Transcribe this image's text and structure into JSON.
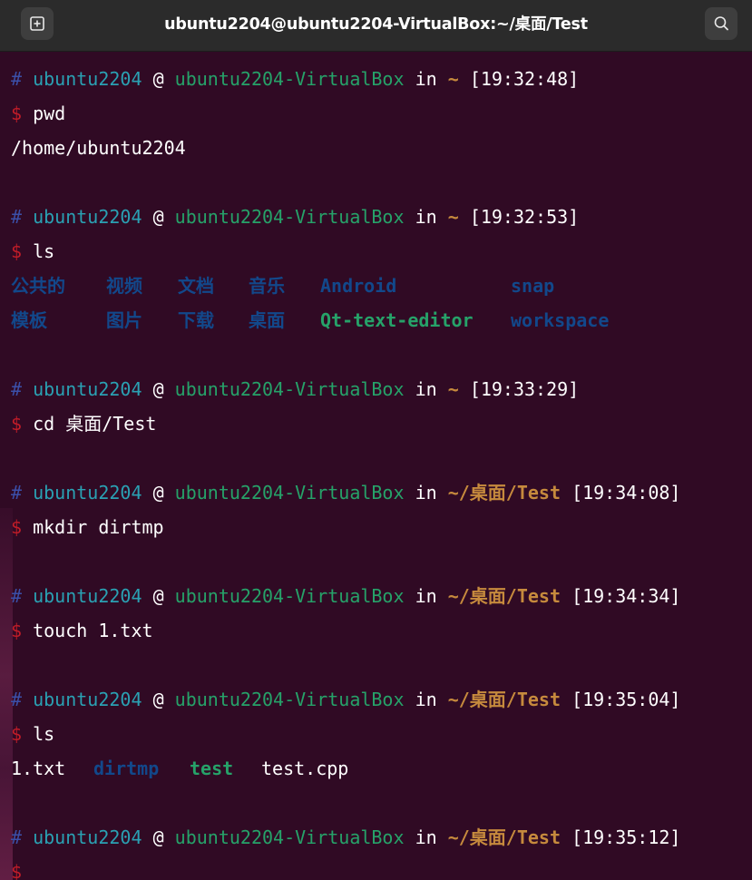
{
  "window": {
    "title": "ubuntu2204@ubuntu2204-VirtualBox:~/桌面/Test",
    "new_tab_icon": "new-tab-icon",
    "search_icon": "search-icon"
  },
  "colors": {
    "background": "#300a24",
    "titlebar": "#2b2b2b",
    "prompt_hash": "#3b4fa8",
    "prompt_user": "#2aa1b3",
    "prompt_host": "#26a269",
    "prompt_path": "#c68a3d",
    "prompt_dollar": "#c01c28",
    "dir_color": "#12488b",
    "exec_color": "#26a269"
  },
  "terminal": {
    "blocks": [
      {
        "prompt": {
          "hash": "#",
          "user": "ubuntu2204",
          "at": "@",
          "host": "ubuntu2204-VirtualBox",
          "in": "in",
          "path": "~",
          "time": "[19:32:48]"
        },
        "dollar": "$",
        "command": "pwd",
        "output": "/home/ubuntu2204"
      },
      {
        "prompt": {
          "hash": "#",
          "user": "ubuntu2204",
          "at": "@",
          "host": "ubuntu2204-VirtualBox",
          "in": "in",
          "path": "~",
          "time": "[19:32:53]"
        },
        "dollar": "$",
        "command": "ls",
        "ls_rows": [
          [
            "公共的",
            "视频",
            "文档",
            "音乐",
            "Android",
            "snap"
          ],
          [
            "模板",
            "图片",
            "下载",
            "桌面",
            "Qt-text-editor",
            "workspace"
          ]
        ]
      },
      {
        "prompt": {
          "hash": "#",
          "user": "ubuntu2204",
          "at": "@",
          "host": "ubuntu2204-VirtualBox",
          "in": "in",
          "path": "~",
          "time": "[19:33:29]"
        },
        "dollar": "$",
        "command": "cd 桌面/Test"
      },
      {
        "prompt": {
          "hash": "#",
          "user": "ubuntu2204",
          "at": "@",
          "host": "ubuntu2204-VirtualBox",
          "in": "in",
          "path": "~/桌面/Test",
          "time": "[19:34:08]"
        },
        "dollar": "$",
        "command": "mkdir dirtmp"
      },
      {
        "prompt": {
          "hash": "#",
          "user": "ubuntu2204",
          "at": "@",
          "host": "ubuntu2204-VirtualBox",
          "in": "in",
          "path": "~/桌面/Test",
          "time": "[19:34:34]"
        },
        "dollar": "$",
        "command": "touch 1.txt"
      },
      {
        "prompt": {
          "hash": "#",
          "user": "ubuntu2204",
          "at": "@",
          "host": "ubuntu2204-VirtualBox",
          "in": "in",
          "path": "~/桌面/Test",
          "time": "[19:35:04]"
        },
        "dollar": "$",
        "command": "ls",
        "ls_items": [
          "1.txt",
          "dirtmp",
          "test",
          "test.cpp"
        ]
      },
      {
        "prompt": {
          "hash": "#",
          "user": "ubuntu2204",
          "at": "@",
          "host": "ubuntu2204-VirtualBox",
          "in": "in",
          "path": "~/桌面/Test",
          "time": "[19:35:12]"
        },
        "dollar": "$",
        "command": ""
      }
    ]
  }
}
